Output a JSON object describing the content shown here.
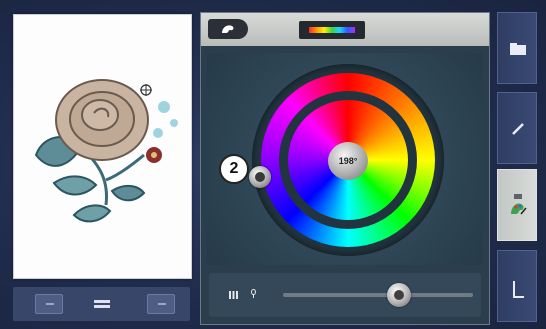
{
  "colors": {
    "background": "#1f2a44",
    "panel": "#2b3e4e",
    "header": "#c9ccc8",
    "sidebar_active": "#d0d3d0"
  },
  "preview": {
    "image": "embroidery-rose-design",
    "nav_prev_icon": "minus-icon",
    "nav_center_icon": "stack-icon",
    "nav_next_icon": "minus-icon"
  },
  "header": {
    "tab_icon": "color-palette-icon",
    "rainbow_icon": "color-bar-icon"
  },
  "color_wheel": {
    "hue_value": "198°",
    "callout_label": "2"
  },
  "brightness_slider": {
    "value_fraction": 0.61,
    "left_icon": "grid-icon",
    "right_icon": "pin-icon"
  },
  "sidebar": {
    "items": [
      {
        "icon": "folder-icon",
        "active": false
      },
      {
        "icon": "pencil-icon",
        "active": false
      },
      {
        "icon": "color-edit-icon",
        "active": true
      },
      {
        "icon": "corner-icon",
        "active": false
      }
    ]
  }
}
